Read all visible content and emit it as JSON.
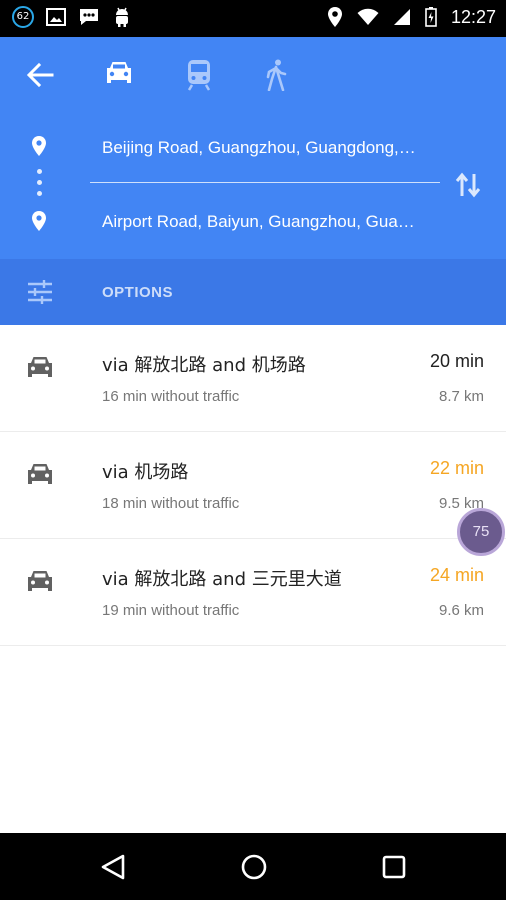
{
  "status_bar": {
    "badge": "62",
    "time": "12:27",
    "left_icons": [
      "notification-badge-icon",
      "image-icon",
      "chat-icon",
      "android-icon"
    ],
    "right_icons": [
      "location-icon",
      "wifi-icon",
      "signal-icon",
      "battery-icon"
    ]
  },
  "header": {
    "modes": [
      "car-icon",
      "transit-icon",
      "walk-icon"
    ],
    "active_mode": "car",
    "from": "Beijing Road, Guangzhou, Guangdong,…",
    "to": "Airport Road, Baiyun, Guangzhou, Gua…",
    "colors": {
      "header": "#4285f4",
      "options": "#3b78e7"
    }
  },
  "options": {
    "label": "OPTIONS"
  },
  "routes": [
    {
      "title": "via 解放北路 and 机场路",
      "time": "20 min",
      "sub": "16 min without traffic",
      "distance": "8.7 km",
      "time_color": "#212121"
    },
    {
      "title": "via 机场路",
      "time": "22 min",
      "sub": "18 min without traffic",
      "distance": "9.5 km",
      "time_color": "#f5a623"
    },
    {
      "title": "via 解放北路 and 三元里大道",
      "time": "24 min",
      "sub": "19 min without traffic",
      "distance": "9.6 km",
      "time_color": "#f5a623"
    }
  ],
  "overlay": {
    "value": "75"
  },
  "nav": [
    "back-icon",
    "home-icon",
    "recents-icon"
  ]
}
